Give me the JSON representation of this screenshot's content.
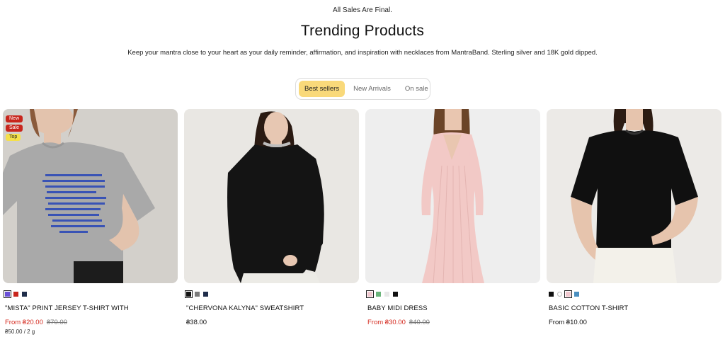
{
  "header": {
    "announcement": "All Sales Are Final.",
    "title": "Trending Products",
    "subtitle": "Keep your mantra close to your heart as your daily reminder, affirmation, and inspiration with necklaces from MantraBand. Sterling silver and 18K gold dipped."
  },
  "tabs": [
    {
      "label": "Best sellers",
      "active": true
    },
    {
      "label": "New Arrivals",
      "active": false
    },
    {
      "label": "On sale",
      "active": false
    }
  ],
  "accent_color": "#f9d97a",
  "sale_color": "#d42a1f",
  "products": [
    {
      "name": "\"MISTA\" PRINT JERSEY T-SHIRT WITH",
      "badges": [
        "New",
        "Sale",
        "Top"
      ],
      "swatches": [
        "#6a4fd6",
        "#c8261d",
        "#1f2d4a"
      ],
      "price": "From ₴20.00",
      "old_price": "₴70.00",
      "unit_price": "₴50.00 / 2 g"
    },
    {
      "name": "\"CHERVONA KALYNA\" SWEATSHIRT",
      "badges": [],
      "swatches": [
        "#111111",
        "#7c7c7c",
        "#1f2d4a"
      ],
      "price": "₴38.00",
      "old_price": "",
      "unit_price": ""
    },
    {
      "name": "BABY MIDI DRESS",
      "badges": [],
      "swatches": [
        "#f1c8cf",
        "#6ab47a",
        "#e8e8e8",
        "#111111"
      ],
      "price": "From ₴30.00",
      "old_price": "₴40.00",
      "unit_price": ""
    },
    {
      "name": "BASIC COTTON T-SHIRT",
      "badges": [],
      "swatches": [
        "#111111",
        "#ffffff",
        "#f1c8cf",
        "#4a8fc0"
      ],
      "price": "From ₴10.00",
      "old_price": "",
      "unit_price": ""
    }
  ]
}
